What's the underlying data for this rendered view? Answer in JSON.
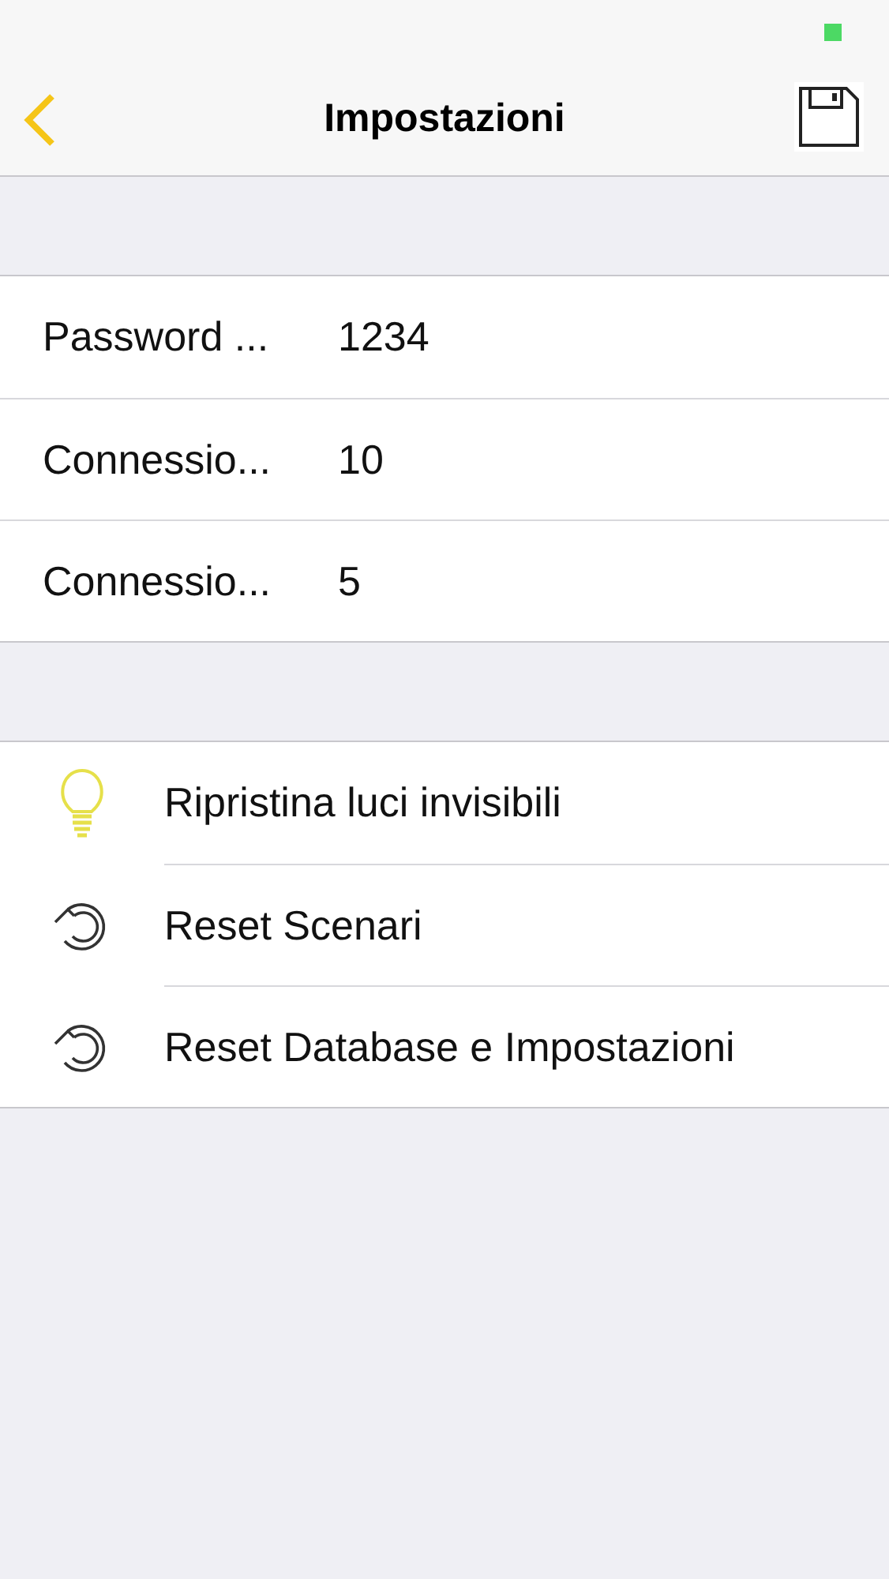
{
  "nav": {
    "title": "Impostazioni"
  },
  "settings": [
    {
      "label": "Password ...",
      "value": "1234"
    },
    {
      "label": "Connessio...",
      "value": "10"
    },
    {
      "label": "Connessio...",
      "value": "5"
    }
  ],
  "actions": [
    {
      "kind": "bulb",
      "label": "Ripristina luci invisibili"
    },
    {
      "kind": "reset",
      "label": "Reset Scenari"
    },
    {
      "kind": "reset",
      "label": "Reset Database e Impostazioni"
    }
  ]
}
